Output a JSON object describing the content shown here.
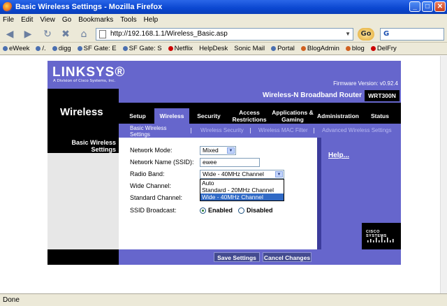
{
  "window": {
    "title": "Basic Wireless Settings - Mozilla Firefox",
    "min_glyph": "_",
    "max_glyph": "□",
    "close_glyph": "✕"
  },
  "menubar": [
    "File",
    "Edit",
    "View",
    "Go",
    "Bookmarks",
    "Tools",
    "Help"
  ],
  "nav": {
    "back_glyph": "◀",
    "forward_glyph": "▶",
    "reload_glyph": "↻",
    "stop_glyph": "✖",
    "home_glyph": "⌂",
    "url": "http://192.168.1.1/Wireless_Basic.asp",
    "url_drop_glyph": "▼",
    "go_label": "Go",
    "search_value": "G"
  },
  "bookmarks": [
    "eWeek",
    "/.",
    "digg",
    "SF Gate: E",
    "SF Gate: S",
    "Netflix",
    "HelpDesk",
    "Sonic Mail",
    "Portal",
    "BlogAdmin",
    "blog",
    "DelFry"
  ],
  "router": {
    "logo": "LINKSYS®",
    "logo_sub": "A Division of Cisco Systems, Inc.",
    "firmware": "Firmware Version: v0.92.4",
    "product_name": "Wireless-N Broadband Router",
    "model": "WRT300N",
    "section_title": "Wireless",
    "tabs": [
      {
        "label": "Setup"
      },
      {
        "label": "Wireless"
      },
      {
        "label": "Security"
      },
      {
        "label": "Access Restrictions"
      },
      {
        "label": "Applications & Gaming"
      },
      {
        "label": "Administration"
      },
      {
        "label": "Status"
      }
    ],
    "subtabs": [
      {
        "label": "Basic Wireless Settings"
      },
      {
        "label": "Wireless Security"
      },
      {
        "label": "Wireless MAC Filter"
      },
      {
        "label": "Advanced Wireless Settings"
      }
    ],
    "separator": "|",
    "left_heading": "Basic Wireless Settings",
    "form": {
      "network_mode_label": "Network Mode:",
      "network_mode_value": "Mixed",
      "ssid_label": "Network Name (SSID):",
      "ssid_value": "ewee",
      "radio_band_label": "Radio Band:",
      "radio_band_value": "Wide - 40MHz Channel",
      "radio_band_options": [
        "Auto",
        "Standard - 20MHz Channel",
        "Wide - 40MHz Channel"
      ],
      "wide_channel_label": "Wide Channel:",
      "standard_channel_label": "Standard Channel:",
      "ssid_broadcast_label": "SSID Broadcast:",
      "enabled_label": "Enabled",
      "disabled_label": "Disabled"
    },
    "help_label": "Help...",
    "cisco_label": "CISCO SYSTEMS",
    "save_label": "Save Settings",
    "cancel_label": "Cancel Changes"
  },
  "status": "Done"
}
